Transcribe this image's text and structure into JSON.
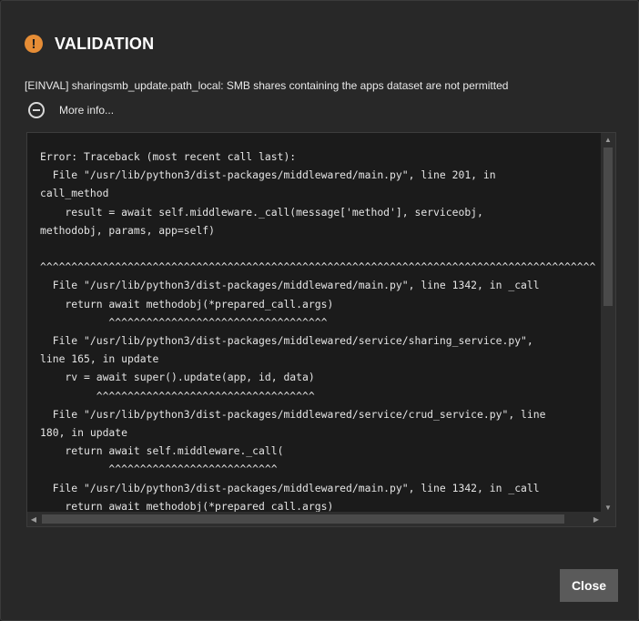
{
  "dialog": {
    "title": "VALIDATION",
    "icon": "warning-icon",
    "accent_color": "#e68d36",
    "message": "[EINVAL] sharingsmb_update.path_local: SMB shares containing the apps dataset are not permitted",
    "more_info_label": "More info...",
    "close_label": "Close"
  },
  "traceback": {
    "lines": [
      "Error: Traceback (most recent call last):",
      "  File \"/usr/lib/python3/dist-packages/middlewared/main.py\", line 201, in",
      "call_method",
      "    result = await self.middleware._call(message['method'], serviceobj,",
      "methodobj, params, app=self)",
      "",
      "^^^^^^^^^^^^^^^^^^^^^^^^^^^^^^^^^^^^^^^^^^^^^^^^^^^^^^^^^^^^^^^^^^^^^^^^^^^^^^^^^^^^^^^^^",
      "  File \"/usr/lib/python3/dist-packages/middlewared/main.py\", line 1342, in _call",
      "    return await methodobj(*prepared_call.args)",
      "           ^^^^^^^^^^^^^^^^^^^^^^^^^^^^^^^^^^^",
      "  File \"/usr/lib/python3/dist-packages/middlewared/service/sharing_service.py\",",
      "line 165, in update",
      "    rv = await super().update(app, id, data)",
      "         ^^^^^^^^^^^^^^^^^^^^^^^^^^^^^^^^^^^",
      "  File \"/usr/lib/python3/dist-packages/middlewared/service/crud_service.py\", line",
      "180, in update",
      "    return await self.middleware._call(",
      "           ^^^^^^^^^^^^^^^^^^^^^^^^^^^",
      "  File \"/usr/lib/python3/dist-packages/middlewared/main.py\", line 1342, in _call",
      "    return await methodobj(*prepared_call.args)"
    ]
  }
}
